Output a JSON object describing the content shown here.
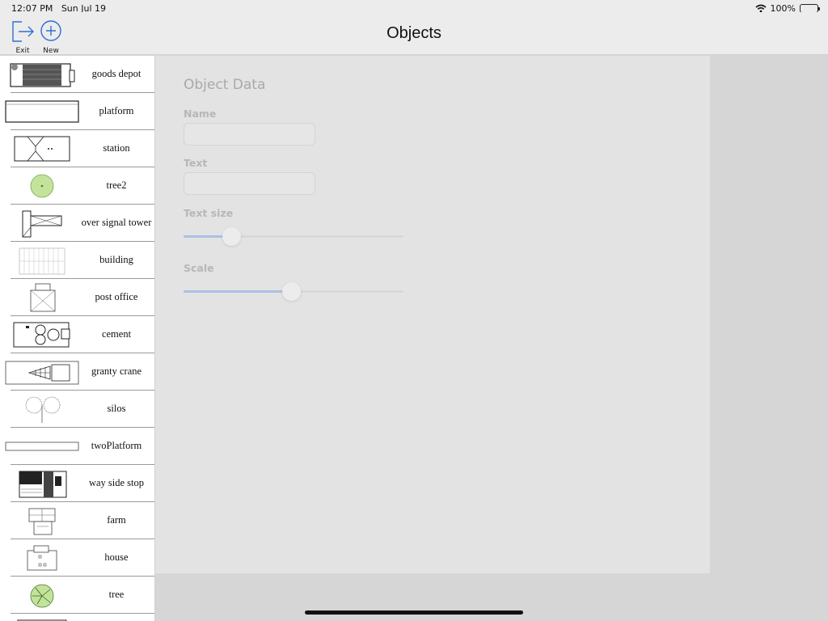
{
  "status_bar": {
    "time": "12:07 PM",
    "date": "Sun Jul 19",
    "battery": "100%",
    "wifi_icon": "wifi-icon",
    "battery_icon": "battery-icon"
  },
  "nav": {
    "title": "Objects",
    "exit": {
      "label": "Exit",
      "icon": "exit-icon"
    },
    "new": {
      "label": "New",
      "icon": "plus-circle-icon"
    },
    "accent_color": "#2f6fd6"
  },
  "objects": [
    {
      "name": "goods depot"
    },
    {
      "name": "platform"
    },
    {
      "name": "station"
    },
    {
      "name": "tree2"
    },
    {
      "name": "over signal tower"
    },
    {
      "name": "building"
    },
    {
      "name": "post office"
    },
    {
      "name": "cement"
    },
    {
      "name": "granty crane"
    },
    {
      "name": "silos"
    },
    {
      "name": "twoPlatform"
    },
    {
      "name": "way side stop"
    },
    {
      "name": "farm"
    },
    {
      "name": "house"
    },
    {
      "name": "tree"
    }
  ],
  "detail": {
    "title": "Object Data",
    "name_label": "Name",
    "name_value": "",
    "text_label": "Text",
    "text_value": "",
    "text_size_label": "Text size",
    "text_size_fraction": 0.22,
    "scale_label": "Scale",
    "scale_fraction": 0.49
  },
  "colors": {
    "slider_fill": "#a9c2e2",
    "tree_green": "#c3e39a"
  }
}
